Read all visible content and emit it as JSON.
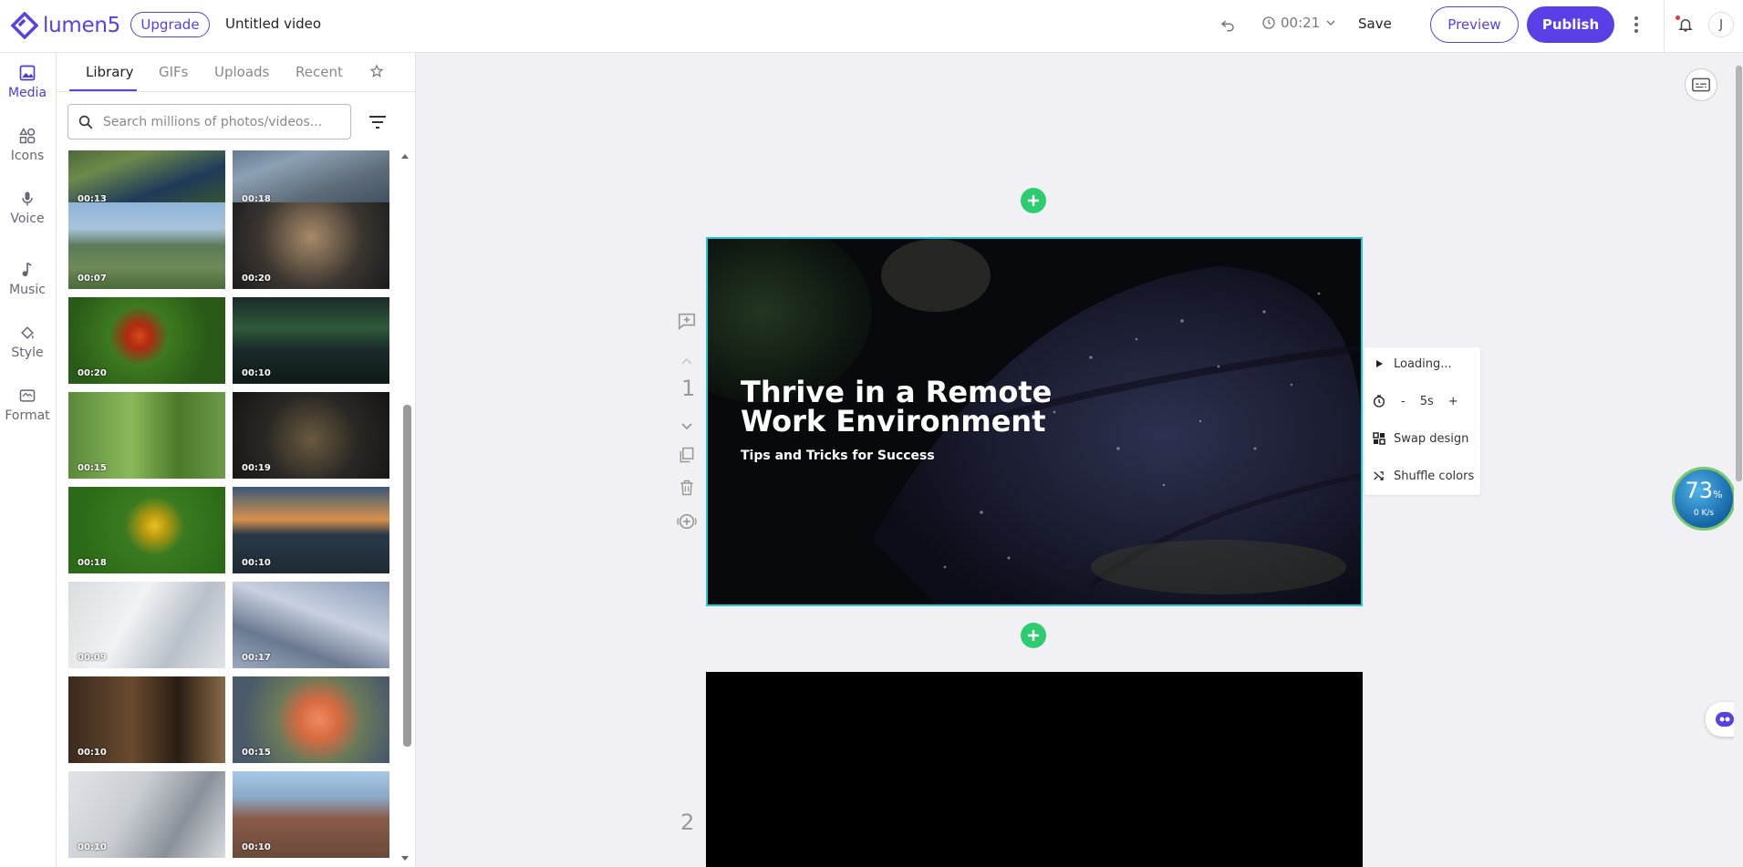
{
  "brand": {
    "name": "lumen5",
    "accent": "#5a3ee6"
  },
  "header": {
    "upgrade_label": "Upgrade",
    "video_title": "Untitled video",
    "duration": "00:21",
    "save_label": "Save",
    "preview_label": "Preview",
    "publish_label": "Publish",
    "avatar_initial": "J"
  },
  "rail": {
    "items": [
      {
        "label": "Media",
        "icon": "image-icon",
        "active": true
      },
      {
        "label": "Icons",
        "icon": "shapes-icon"
      },
      {
        "label": "Voice",
        "icon": "microphone-icon"
      },
      {
        "label": "Music",
        "icon": "music-note-icon"
      },
      {
        "label": "Style",
        "icon": "paint-bucket-icon"
      },
      {
        "label": "Format",
        "icon": "aspect-ratio-icon"
      }
    ]
  },
  "media_panel": {
    "tabs": [
      "Library",
      "GIFs",
      "Uploads",
      "Recent"
    ],
    "active_tab": "Library",
    "search_placeholder": "Search millions of photos/videos...",
    "thumbnails": [
      {
        "duration": "00:13"
      },
      {
        "duration": "00:18"
      },
      {
        "duration": "00:07"
      },
      {
        "duration": "00:20"
      },
      {
        "duration": "00:20"
      },
      {
        "duration": "00:10"
      },
      {
        "duration": "00:15"
      },
      {
        "duration": "00:19"
      },
      {
        "duration": "00:18"
      },
      {
        "duration": "00:10"
      },
      {
        "duration": "00:09"
      },
      {
        "duration": "00:17"
      },
      {
        "duration": "00:10"
      },
      {
        "duration": "00:15"
      },
      {
        "duration": "00:10"
      },
      {
        "duration": "00:10"
      }
    ]
  },
  "scenes": [
    {
      "number": "1",
      "title_line1": "Thrive in a Remote",
      "title_line2": "Work Environment",
      "subtitle": "Tips and Tricks for Success"
    },
    {
      "number": "2"
    }
  ],
  "scene_menu": {
    "loading_label": "Loading...",
    "duration_minus": "-",
    "duration_value": "5s",
    "duration_plus": "+",
    "swap_label": "Swap design",
    "shuffle_label": "Shuffle colors"
  },
  "speed_widget": {
    "percent": "73",
    "percent_sign": "%",
    "rate": "0 K/s"
  }
}
